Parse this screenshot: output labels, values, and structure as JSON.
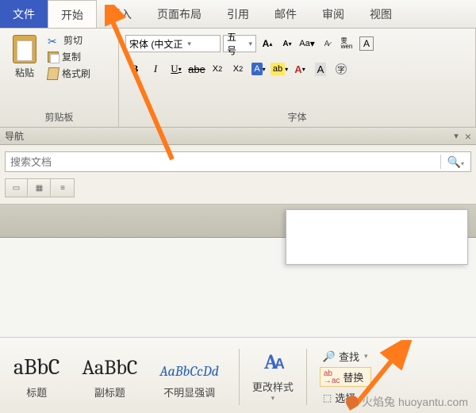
{
  "tabs": {
    "file": "文件",
    "home": "开始",
    "insert": "插入",
    "layout": "页面布局",
    "references": "引用",
    "mail": "邮件",
    "review": "审阅",
    "view": "视图"
  },
  "clipboard": {
    "paste": "粘贴",
    "cut": "剪切",
    "copy": "复制",
    "format_painter": "格式刷",
    "group_label": "剪贴板"
  },
  "font": {
    "name": "宋体 (中文正",
    "size": "五号",
    "group_label": "字体"
  },
  "nav": {
    "title": "导航",
    "search_placeholder": "搜索文档"
  },
  "styles": {
    "heading_preview": "aBbC",
    "heading_label": "标题",
    "sub_preview": "AaBbC",
    "sub_label": "副标题",
    "emph_preview": "AaBbCcDd",
    "emph_label": "不明显强调",
    "change_label": "更改样式"
  },
  "editing": {
    "find": "查找",
    "replace": "替换",
    "select": "选择"
  },
  "watermark": {
    "brand": "火焰兔",
    "url": "huoyantu.com"
  }
}
